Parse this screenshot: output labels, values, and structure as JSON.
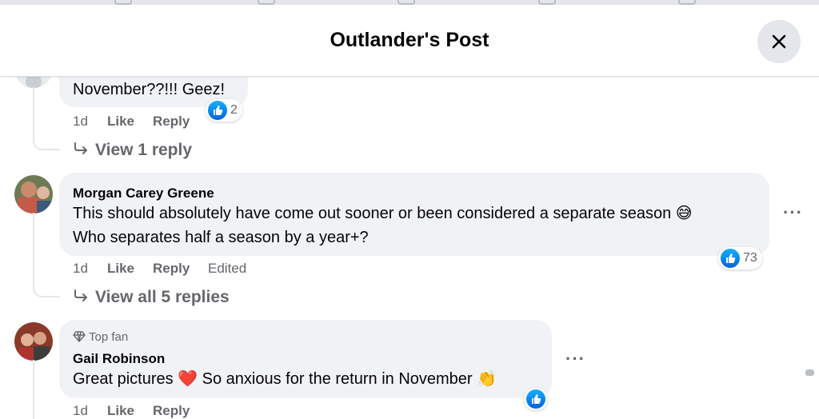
{
  "dialog": {
    "title": "Outlander's Post"
  },
  "comments": [
    {
      "text_line1": "November??!!! Geez!",
      "reactions": "2",
      "time": "1d",
      "like_label": "Like",
      "reply_label": "Reply",
      "view_replies": "View 1 reply"
    },
    {
      "author": "Morgan Carey Greene",
      "text_line1": "This should absolutely have come out sooner or been considered a separate season 😅",
      "text_line2": "Who separates half a season by a year+?",
      "reactions": "73",
      "time": "1d",
      "like_label": "Like",
      "reply_label": "Reply",
      "edited_label": "Edited",
      "view_replies": "View all 5 replies"
    },
    {
      "badge": "Top fan",
      "author": "Gail Robinson",
      "text_line1": "Great pictures ❤️ So anxious for the return in November 👏",
      "time": "1d",
      "like_label": "Like",
      "reply_label": "Reply"
    }
  ],
  "icons": {
    "close": "close-icon",
    "like": "like-icon",
    "more": "more-options-icon",
    "reply_arrow": "reply-arrow-icon",
    "top_fan": "diamond-icon"
  },
  "colors": {
    "bubble": "#f0f2f5",
    "secondary_text": "#65676b",
    "like_blue": "#0866ff"
  }
}
